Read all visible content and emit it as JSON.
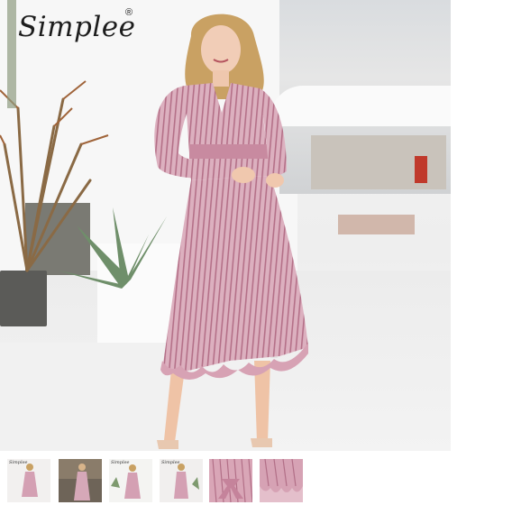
{
  "brand": {
    "logo_text": "Simplee",
    "registered_mark": "®"
  },
  "main_image": {
    "icon": "product-photo-pink-striped-wrap-dress",
    "colors": {
      "dress": "#d9a9b8",
      "stripe": "#b57388",
      "wall": "#f7f7f7"
    }
  },
  "thumbnails": [
    {
      "icon": "thumb-full-dress-front",
      "logo": "Simplee",
      "selected": false
    },
    {
      "icon": "thumb-dress-indoor",
      "logo": "",
      "selected": false
    },
    {
      "icon": "thumb-dress-outdoor",
      "logo": "Simplee",
      "selected": false
    },
    {
      "icon": "thumb-dress-side",
      "logo": "Simplee",
      "selected": false
    },
    {
      "icon": "thumb-waist-tie-detail",
      "logo": "",
      "selected": false
    },
    {
      "icon": "thumb-ruffle-hem-detail",
      "logo": "",
      "selected": false
    }
  ]
}
